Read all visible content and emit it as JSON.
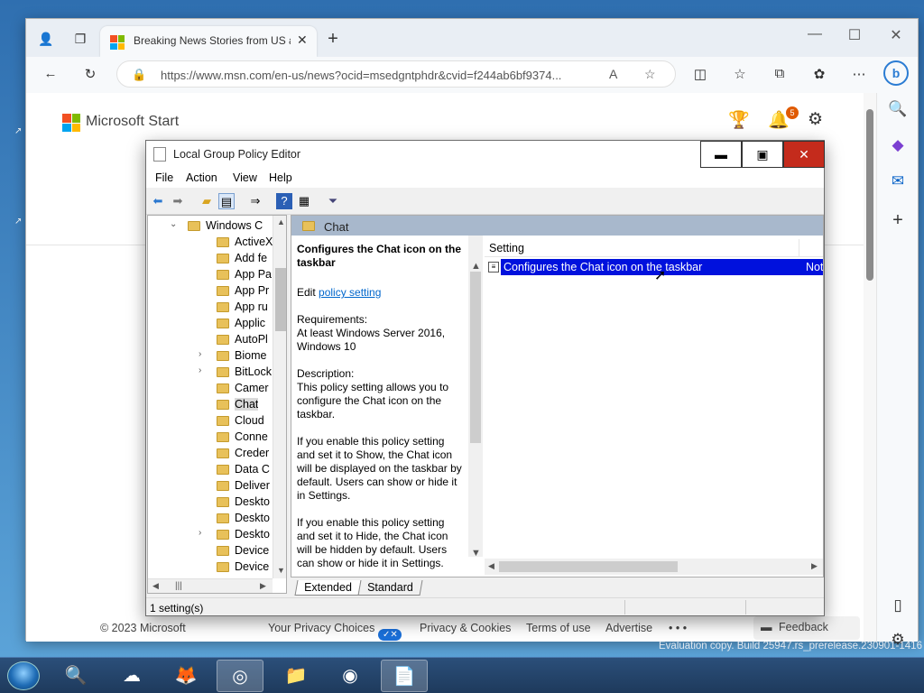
{
  "browser": {
    "tab_title": "Breaking News Stories from US a",
    "url": "https://www.msn.com/en-us/news?ocid=msedgntphdr&cvid=f244ab6bf9374...",
    "notification_count": "5"
  },
  "msn": {
    "brand": "Microsoft Start",
    "footer": {
      "copyright": "© 2023 Microsoft",
      "privacy_choices": "Your Privacy Choices",
      "privacy_cookies": "Privacy & Cookies",
      "terms": "Terms of use",
      "advertise": "Advertise",
      "more": "• • •",
      "feedback": "Feedback"
    }
  },
  "gpe": {
    "title": "Local Group Policy Editor",
    "menu": [
      "File",
      "Action",
      "View",
      "Help"
    ],
    "tree": [
      {
        "label": "Windows C",
        "expander": "down",
        "selected": false
      },
      {
        "label": "ActiveX",
        "expander": "",
        "selected": false
      },
      {
        "label": "Add fe",
        "expander": "",
        "selected": false
      },
      {
        "label": "App Pa",
        "expander": "",
        "selected": false
      },
      {
        "label": "App Pr",
        "expander": "",
        "selected": false
      },
      {
        "label": "App ru",
        "expander": "",
        "selected": false
      },
      {
        "label": "Applic",
        "expander": "",
        "selected": false
      },
      {
        "label": "AutoPl",
        "expander": "",
        "selected": false
      },
      {
        "label": "Biome",
        "expander": "right",
        "selected": false
      },
      {
        "label": "BitLock",
        "expander": "right",
        "selected": false
      },
      {
        "label": "Camer",
        "expander": "",
        "selected": false
      },
      {
        "label": "Chat",
        "expander": "",
        "selected": true
      },
      {
        "label": "Cloud",
        "expander": "",
        "selected": false
      },
      {
        "label": "Conne",
        "expander": "",
        "selected": false
      },
      {
        "label": "Creder",
        "expander": "",
        "selected": false
      },
      {
        "label": "Data C",
        "expander": "",
        "selected": false
      },
      {
        "label": "Deliver",
        "expander": "",
        "selected": false
      },
      {
        "label": "Deskto",
        "expander": "",
        "selected": false
      },
      {
        "label": "Deskto",
        "expander": "",
        "selected": false
      },
      {
        "label": "Deskto",
        "expander": "right",
        "selected": false
      },
      {
        "label": "Device",
        "expander": "",
        "selected": false
      },
      {
        "label": "Device",
        "expander": "",
        "selected": false
      }
    ],
    "folder_header": "Chat",
    "desc": {
      "title": "Configures the Chat icon on the taskbar",
      "edit_prefix": "Edit",
      "edit_link": "policy setting",
      "requirements_label": "Requirements:",
      "requirements": "At least Windows Server 2016, Windows 10",
      "description_label": "Description:",
      "p1": "This policy setting allows you to configure the Chat icon on the taskbar.",
      "p2": "If you enable this policy setting and set it to Show, the Chat icon will be displayed on the taskbar by default. Users can show or hide it in Settings.",
      "p3": "If you enable this policy setting and set it to Hide, the Chat icon will be hidden by default. Users can show or hide it in Settings."
    },
    "list": {
      "column": "Setting",
      "row_setting": "Configures the Chat icon on the taskbar",
      "row_state": "Not"
    },
    "tabs": [
      "Extended",
      "Standard"
    ],
    "status": "1 setting(s)"
  },
  "watermark": "Evaluation copy. Build 25947.rs_prerelease.230901-1416",
  "colors": {
    "selection": "#0011dd",
    "close_button": "#c42b1c",
    "link": "#0066cc",
    "badge": "#e05a00"
  }
}
